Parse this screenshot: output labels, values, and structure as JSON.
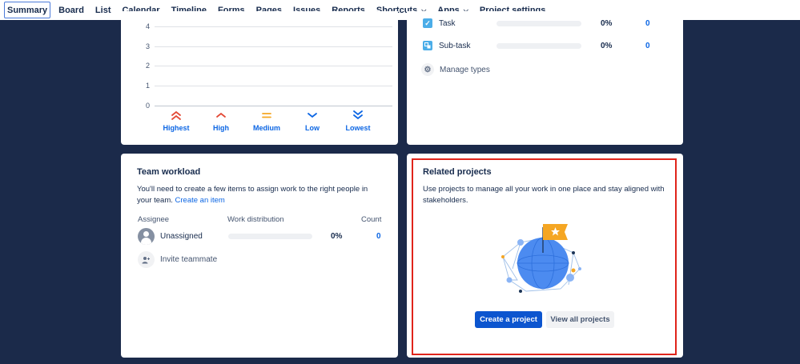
{
  "nav": {
    "items": [
      {
        "label": "Summary",
        "active": true
      },
      {
        "label": "Board"
      },
      {
        "label": "List"
      },
      {
        "label": "Calendar"
      },
      {
        "label": "Timeline"
      },
      {
        "label": "Forms"
      },
      {
        "label": "Pages"
      },
      {
        "label": "Issues"
      },
      {
        "label": "Reports"
      },
      {
        "label": "Shortcuts",
        "dropdown": true
      },
      {
        "label": "Apps",
        "dropdown": true
      },
      {
        "label": "Project settings"
      }
    ]
  },
  "priority": {
    "y_ticks": [
      "4",
      "3",
      "2",
      "1",
      "0"
    ],
    "levels": [
      {
        "label": "Highest",
        "icon": "priority-highest-icon",
        "color": "#e34935"
      },
      {
        "label": "High",
        "icon": "priority-high-icon",
        "color": "#e34935"
      },
      {
        "label": "Medium",
        "icon": "priority-medium-icon",
        "color": "#f5a623"
      },
      {
        "label": "Low",
        "icon": "priority-low-icon",
        "color": "#0c66e4"
      },
      {
        "label": "Lowest",
        "icon": "priority-lowest-icon",
        "color": "#0c66e4"
      }
    ]
  },
  "types": {
    "rows": [
      {
        "name": "Task",
        "pct": "0%",
        "count": "0",
        "icon": "task-checkbox-icon",
        "color": "#4bade8"
      },
      {
        "name": "Sub-task",
        "pct": "0%",
        "count": "0",
        "icon": "subtask-icon",
        "color": "#4bade8"
      }
    ],
    "manage_label": "Manage types"
  },
  "workload": {
    "title": "Team workload",
    "desc_text": "You'll need to create a few items to assign work to the right people in your team.",
    "desc_link": "Create an item",
    "col_assignee": "Assignee",
    "col_distribution": "Work distribution",
    "col_count": "Count",
    "row": {
      "name": "Unassigned",
      "pct": "0%",
      "count": "0"
    },
    "invite_label": "Invite teammate"
  },
  "related": {
    "title": "Related projects",
    "desc": "Use projects to manage all your work in one place and stay aligned with stakeholders.",
    "create_label": "Create a project",
    "view_label": "View all projects"
  }
}
